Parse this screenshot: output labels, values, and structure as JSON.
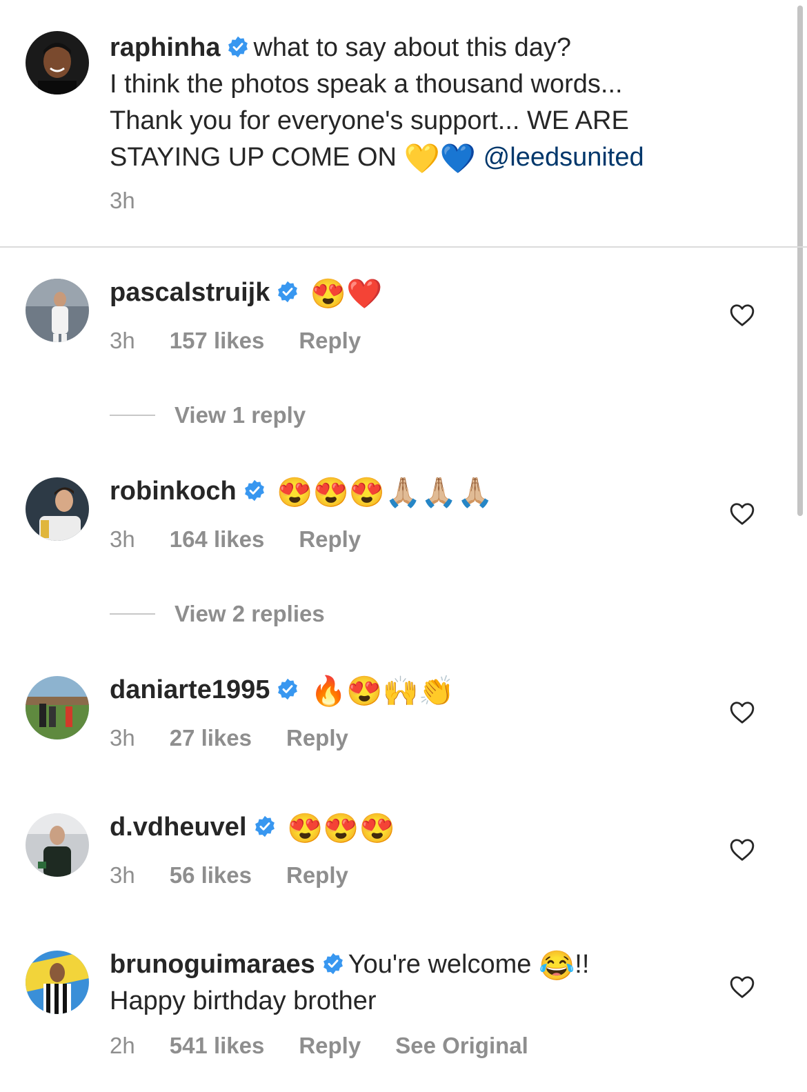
{
  "post_caption": {
    "username": "raphinha",
    "text_lines": [
      "what to say about this day?",
      "I think the photos speak a thousand words...",
      "Thank you for everyone's support...  WE ARE",
      "STAYING UP COME ON"
    ],
    "emojis": "💛💙",
    "mention": "@leedsunited",
    "time": "3h"
  },
  "comments": [
    {
      "username": "pascalstruijk",
      "text": "😍❤️",
      "time": "3h",
      "likes": "157 likes",
      "reply_label": "Reply",
      "view_replies": "View 1 reply"
    },
    {
      "username": "robinkoch",
      "text": "😍😍😍🙏🏼🙏🏼🙏🏼",
      "time": "3h",
      "likes": "164 likes",
      "reply_label": "Reply",
      "view_replies": "View 2 replies"
    },
    {
      "username": "daniarte1995",
      "text": "🔥😍🙌👏",
      "time": "3h",
      "likes": "27 likes",
      "reply_label": "Reply"
    },
    {
      "username": "d.vdheuvel",
      "text": "😍😍😍",
      "time": "3h",
      "likes": "56 likes",
      "reply_label": "Reply"
    },
    {
      "username": "brunoguimaraes",
      "text_line1": "You're welcome",
      "emoji": "😂",
      "text_suffix": "!!",
      "text_line2": "Happy birthday brother",
      "time": "2h",
      "likes": "541 likes",
      "reply_label": "Reply",
      "see_original": "See Original"
    }
  ],
  "colors": {
    "verified_badge": "#3897f0",
    "mention": "#00376b",
    "meta_gray": "#8e8e8e",
    "divider": "#dbdbdb"
  },
  "icons": {
    "verified": "verified-badge-icon",
    "like": "heart-outline-icon"
  }
}
